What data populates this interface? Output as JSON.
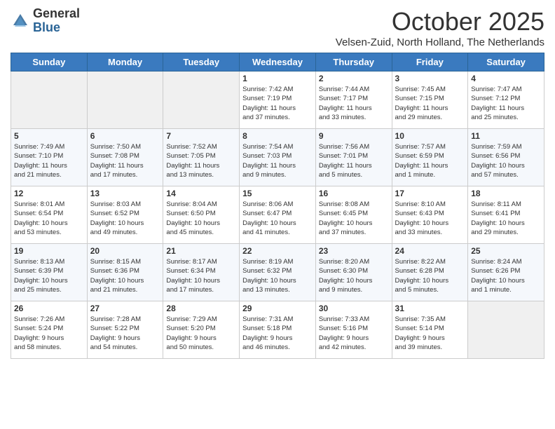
{
  "logo": {
    "general": "General",
    "blue": "Blue"
  },
  "header": {
    "month": "October 2025",
    "location": "Velsen-Zuid, North Holland, The Netherlands"
  },
  "days_of_week": [
    "Sunday",
    "Monday",
    "Tuesday",
    "Wednesday",
    "Thursday",
    "Friday",
    "Saturday"
  ],
  "weeks": [
    [
      {
        "day": "",
        "info": ""
      },
      {
        "day": "",
        "info": ""
      },
      {
        "day": "",
        "info": ""
      },
      {
        "day": "1",
        "info": "Sunrise: 7:42 AM\nSunset: 7:19 PM\nDaylight: 11 hours\nand 37 minutes."
      },
      {
        "day": "2",
        "info": "Sunrise: 7:44 AM\nSunset: 7:17 PM\nDaylight: 11 hours\nand 33 minutes."
      },
      {
        "day": "3",
        "info": "Sunrise: 7:45 AM\nSunset: 7:15 PM\nDaylight: 11 hours\nand 29 minutes."
      },
      {
        "day": "4",
        "info": "Sunrise: 7:47 AM\nSunset: 7:12 PM\nDaylight: 11 hours\nand 25 minutes."
      }
    ],
    [
      {
        "day": "5",
        "info": "Sunrise: 7:49 AM\nSunset: 7:10 PM\nDaylight: 11 hours\nand 21 minutes."
      },
      {
        "day": "6",
        "info": "Sunrise: 7:50 AM\nSunset: 7:08 PM\nDaylight: 11 hours\nand 17 minutes."
      },
      {
        "day": "7",
        "info": "Sunrise: 7:52 AM\nSunset: 7:05 PM\nDaylight: 11 hours\nand 13 minutes."
      },
      {
        "day": "8",
        "info": "Sunrise: 7:54 AM\nSunset: 7:03 PM\nDaylight: 11 hours\nand 9 minutes."
      },
      {
        "day": "9",
        "info": "Sunrise: 7:56 AM\nSunset: 7:01 PM\nDaylight: 11 hours\nand 5 minutes."
      },
      {
        "day": "10",
        "info": "Sunrise: 7:57 AM\nSunset: 6:59 PM\nDaylight: 11 hours\nand 1 minute."
      },
      {
        "day": "11",
        "info": "Sunrise: 7:59 AM\nSunset: 6:56 PM\nDaylight: 10 hours\nand 57 minutes."
      }
    ],
    [
      {
        "day": "12",
        "info": "Sunrise: 8:01 AM\nSunset: 6:54 PM\nDaylight: 10 hours\nand 53 minutes."
      },
      {
        "day": "13",
        "info": "Sunrise: 8:03 AM\nSunset: 6:52 PM\nDaylight: 10 hours\nand 49 minutes."
      },
      {
        "day": "14",
        "info": "Sunrise: 8:04 AM\nSunset: 6:50 PM\nDaylight: 10 hours\nand 45 minutes."
      },
      {
        "day": "15",
        "info": "Sunrise: 8:06 AM\nSunset: 6:47 PM\nDaylight: 10 hours\nand 41 minutes."
      },
      {
        "day": "16",
        "info": "Sunrise: 8:08 AM\nSunset: 6:45 PM\nDaylight: 10 hours\nand 37 minutes."
      },
      {
        "day": "17",
        "info": "Sunrise: 8:10 AM\nSunset: 6:43 PM\nDaylight: 10 hours\nand 33 minutes."
      },
      {
        "day": "18",
        "info": "Sunrise: 8:11 AM\nSunset: 6:41 PM\nDaylight: 10 hours\nand 29 minutes."
      }
    ],
    [
      {
        "day": "19",
        "info": "Sunrise: 8:13 AM\nSunset: 6:39 PM\nDaylight: 10 hours\nand 25 minutes."
      },
      {
        "day": "20",
        "info": "Sunrise: 8:15 AM\nSunset: 6:36 PM\nDaylight: 10 hours\nand 21 minutes."
      },
      {
        "day": "21",
        "info": "Sunrise: 8:17 AM\nSunset: 6:34 PM\nDaylight: 10 hours\nand 17 minutes."
      },
      {
        "day": "22",
        "info": "Sunrise: 8:19 AM\nSunset: 6:32 PM\nDaylight: 10 hours\nand 13 minutes."
      },
      {
        "day": "23",
        "info": "Sunrise: 8:20 AM\nSunset: 6:30 PM\nDaylight: 10 hours\nand 9 minutes."
      },
      {
        "day": "24",
        "info": "Sunrise: 8:22 AM\nSunset: 6:28 PM\nDaylight: 10 hours\nand 5 minutes."
      },
      {
        "day": "25",
        "info": "Sunrise: 8:24 AM\nSunset: 6:26 PM\nDaylight: 10 hours\nand 1 minute."
      }
    ],
    [
      {
        "day": "26",
        "info": "Sunrise: 7:26 AM\nSunset: 5:24 PM\nDaylight: 9 hours\nand 58 minutes."
      },
      {
        "day": "27",
        "info": "Sunrise: 7:28 AM\nSunset: 5:22 PM\nDaylight: 9 hours\nand 54 minutes."
      },
      {
        "day": "28",
        "info": "Sunrise: 7:29 AM\nSunset: 5:20 PM\nDaylight: 9 hours\nand 50 minutes."
      },
      {
        "day": "29",
        "info": "Sunrise: 7:31 AM\nSunset: 5:18 PM\nDaylight: 9 hours\nand 46 minutes."
      },
      {
        "day": "30",
        "info": "Sunrise: 7:33 AM\nSunset: 5:16 PM\nDaylight: 9 hours\nand 42 minutes."
      },
      {
        "day": "31",
        "info": "Sunrise: 7:35 AM\nSunset: 5:14 PM\nDaylight: 9 hours\nand 39 minutes."
      },
      {
        "day": "",
        "info": ""
      }
    ]
  ]
}
